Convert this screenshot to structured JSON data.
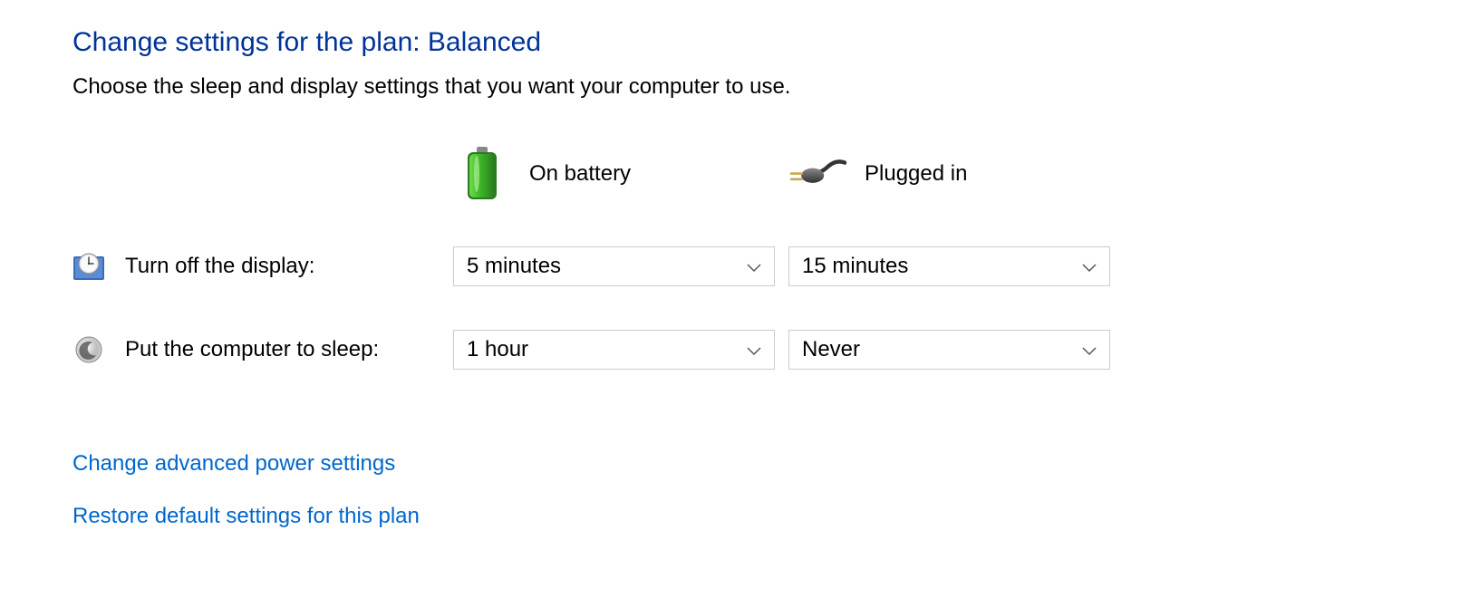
{
  "title": "Change settings for the plan: Balanced",
  "subtitle": "Choose the sleep and display settings that you want your computer to use.",
  "columns": {
    "battery": "On battery",
    "plugged": "Plugged in"
  },
  "rows": {
    "display": {
      "label": "Turn off the display:",
      "battery_value": "5 minutes",
      "plugged_value": "15 minutes"
    },
    "sleep": {
      "label": "Put the computer to sleep:",
      "battery_value": "1 hour",
      "plugged_value": "Never"
    }
  },
  "links": {
    "advanced": "Change advanced power settings",
    "restore": "Restore default settings for this plan"
  }
}
